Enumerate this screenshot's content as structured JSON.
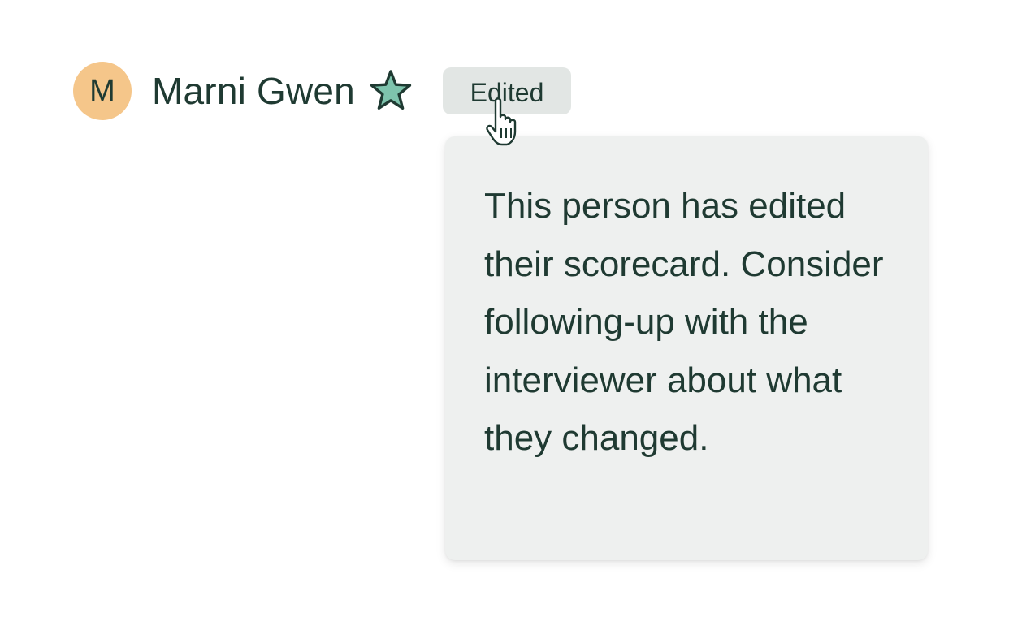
{
  "candidate": {
    "avatar_initial": "M",
    "name": "Marni Gwen",
    "star_icon": "star-icon",
    "badge_label": "Edited"
  },
  "tooltip": {
    "text": "This person has edited their scorecard. Consider following-up with the interviewer about what they changed."
  },
  "colors": {
    "avatar_bg": "#f5c68a",
    "star_fill": "#7ec4ad",
    "text": "#1f3a32",
    "badge_bg": "#e2e6e4",
    "tooltip_bg": "#eef0ef"
  },
  "cursor": "hand-pointer-icon"
}
